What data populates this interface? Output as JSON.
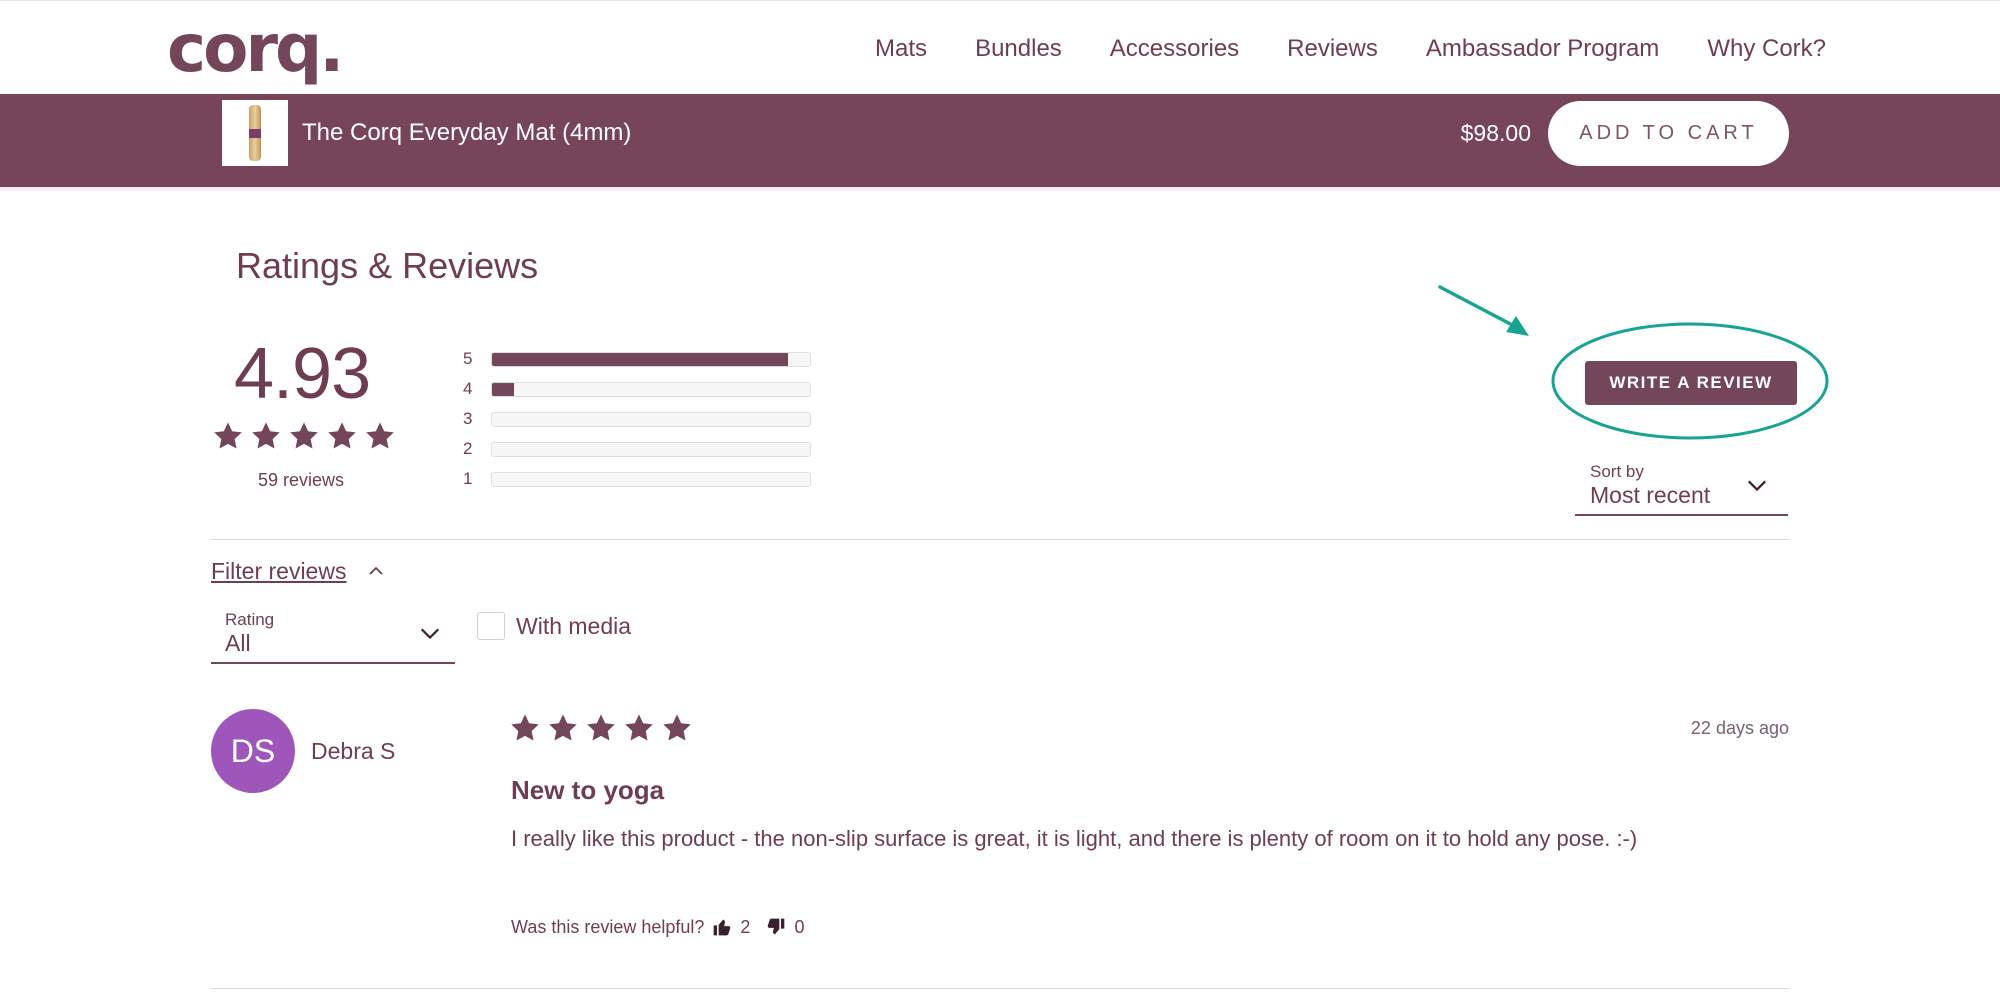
{
  "header": {
    "logo": "corq.",
    "nav": [
      "Mats",
      "Bundles",
      "Accessories",
      "Reviews",
      "Ambassador Program",
      "Why Cork?"
    ]
  },
  "product_bar": {
    "title": "The Corq Everyday Mat (4mm)",
    "price": "$98.00",
    "cta": "ADD TO CART"
  },
  "reviews": {
    "heading": "Ratings & Reviews",
    "average": "4.93",
    "count_label": "59 reviews",
    "average_stars": 5,
    "distribution": [
      {
        "label": "5",
        "fraction": 0.93
      },
      {
        "label": "4",
        "fraction": 0.07
      },
      {
        "label": "3",
        "fraction": 0
      },
      {
        "label": "2",
        "fraction": 0
      },
      {
        "label": "1",
        "fraction": 0
      }
    ],
    "write_button": "WRITE A REVIEW",
    "sort": {
      "label": "Sort by",
      "value": "Most recent"
    },
    "filter": {
      "link": "Filter reviews",
      "rating_label": "Rating",
      "rating_value": "All",
      "media_label": "With media"
    }
  },
  "review_item": {
    "initials": "DS",
    "name": "Debra S",
    "stars": 5,
    "date": "22 days ago",
    "title": "New to yoga",
    "body": "I really like this product - the non-slip surface is great, it is light,  and there is plenty of room on it to hold any pose. :-)",
    "helpful_label": "Was this review helpful?",
    "up_count": "2",
    "down_count": "0"
  },
  "colors": {
    "brand": "#74465a",
    "product_bar": "#77455a",
    "avatar": "#9e56bb",
    "annotation": "#19a393"
  },
  "icons": [
    "star-icon",
    "chevron-down-icon",
    "chevron-up-icon",
    "thumbs-up-icon",
    "thumbs-down-icon"
  ]
}
